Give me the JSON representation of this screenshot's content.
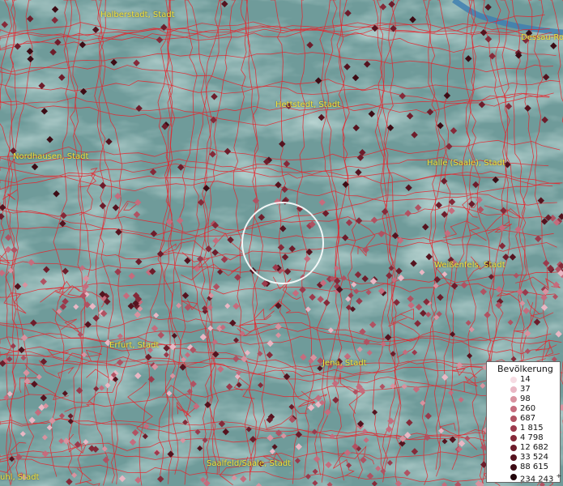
{
  "map": {
    "colors": {
      "background": "#6f9b9a",
      "boundary": "#e8232b",
      "city_label": "#f2e23a",
      "selection_circle": "#ffffff"
    },
    "cities": [
      {
        "id": "halberstadt",
        "label": "Halberstadt, Stadt"
      },
      {
        "id": "dessau",
        "label": "Dessau-Ro"
      },
      {
        "id": "hettstedt",
        "label": "Hettstedt, Stadt"
      },
      {
        "id": "nordhausen",
        "label": "Nordhausen, Stadt"
      },
      {
        "id": "halle",
        "label": "Halle (Saale), Stadt"
      },
      {
        "id": "weissenfels",
        "label": "Weißenfels, Stadt"
      },
      {
        "id": "erfurt",
        "label": "Erfurt, Stadt"
      },
      {
        "id": "jena",
        "label": "Jena, Stadt"
      },
      {
        "id": "saalfeld",
        "label": "Saalfeld/Saale, Stadt"
      },
      {
        "id": "suhl",
        "label": "uhl, Stadt"
      }
    ],
    "legend": {
      "title": "Bevölkerung",
      "classes": [
        {
          "label": "14",
          "color": "#f6dce3"
        },
        {
          "label": "37",
          "color": "#e9b7c4"
        },
        {
          "label": "98",
          "color": "#d8929f"
        },
        {
          "label": "260",
          "color": "#c56c7d"
        },
        {
          "label": "687",
          "color": "#b05262"
        },
        {
          "label": "1 815",
          "color": "#9b3a4c"
        },
        {
          "label": "4 798",
          "color": "#852a39"
        },
        {
          "label": "12 682",
          "color": "#6d1d2b"
        },
        {
          "label": "33 524",
          "color": "#55131f"
        },
        {
          "label": "88 615",
          "color": "#3d0c15"
        },
        {
          "label": "234 243",
          "color": "#22060b",
          "suffix": "+"
        }
      ]
    }
  }
}
